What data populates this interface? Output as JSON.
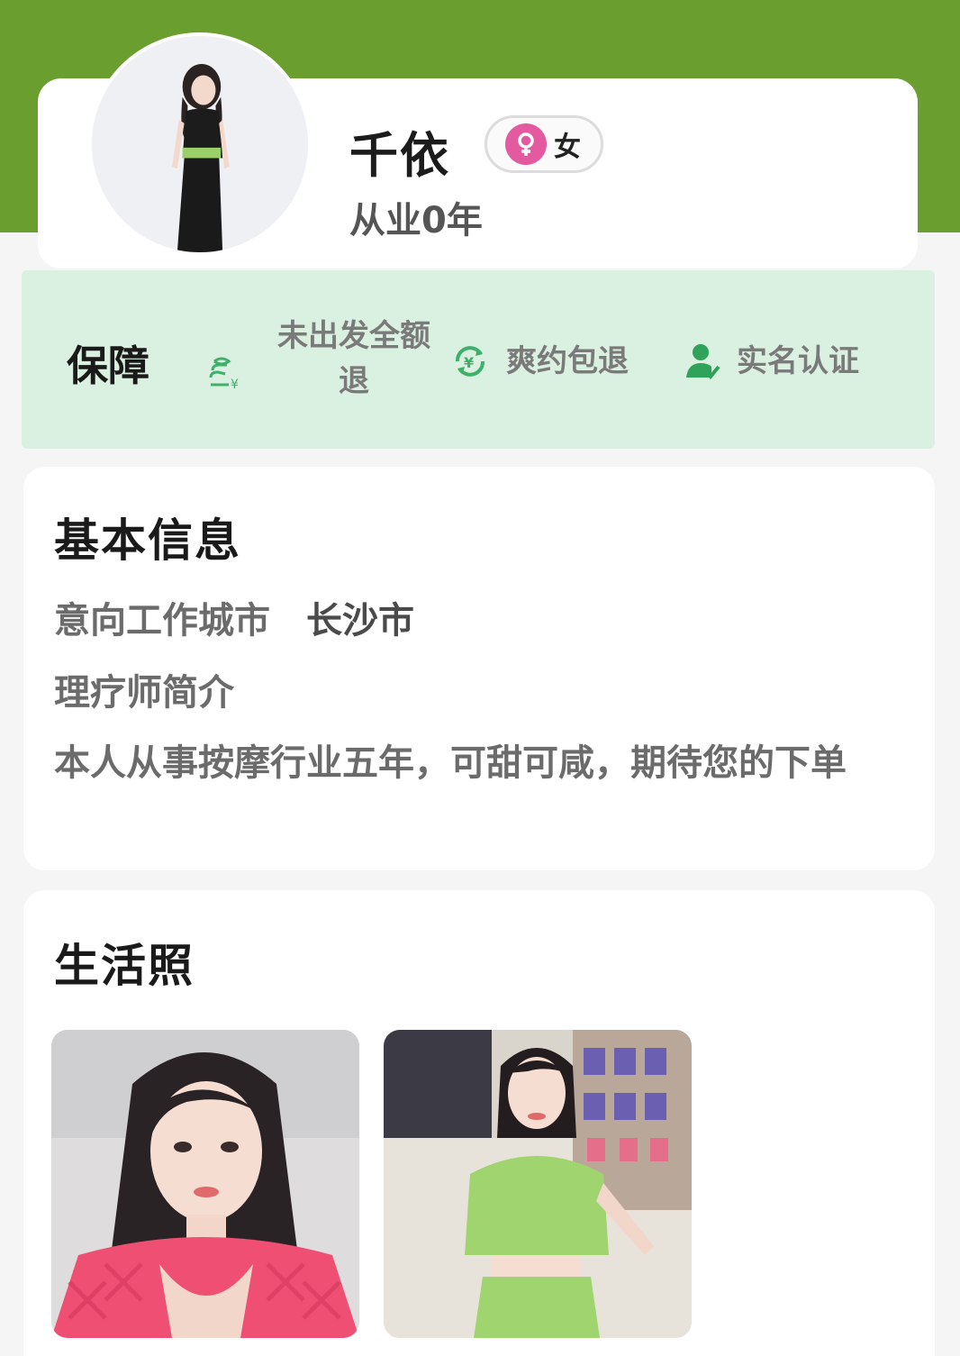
{
  "profile": {
    "name": "千依",
    "gender_label": "女",
    "gender_icon": "female-symbol-icon",
    "experience": "从业0年",
    "header_color": "#6a9e2f"
  },
  "guarantee": {
    "title": "保障",
    "background": "#daf0e1",
    "items": [
      {
        "label": "未出发全额退",
        "icon": "refund-coin-icon"
      },
      {
        "label": "爽约包退",
        "icon": "yuan-refresh-icon"
      },
      {
        "label": "实名认证",
        "icon": "verified-user-icon"
      }
    ]
  },
  "basic_info": {
    "title": "基本信息",
    "city_label": "意向工作城市",
    "city_value": "长沙市",
    "intro_label": "理疗师简介",
    "intro_text": "本人从事按摩行业五年，可甜可咸，期待您的下单"
  },
  "life_photos": {
    "title": "生活照"
  }
}
